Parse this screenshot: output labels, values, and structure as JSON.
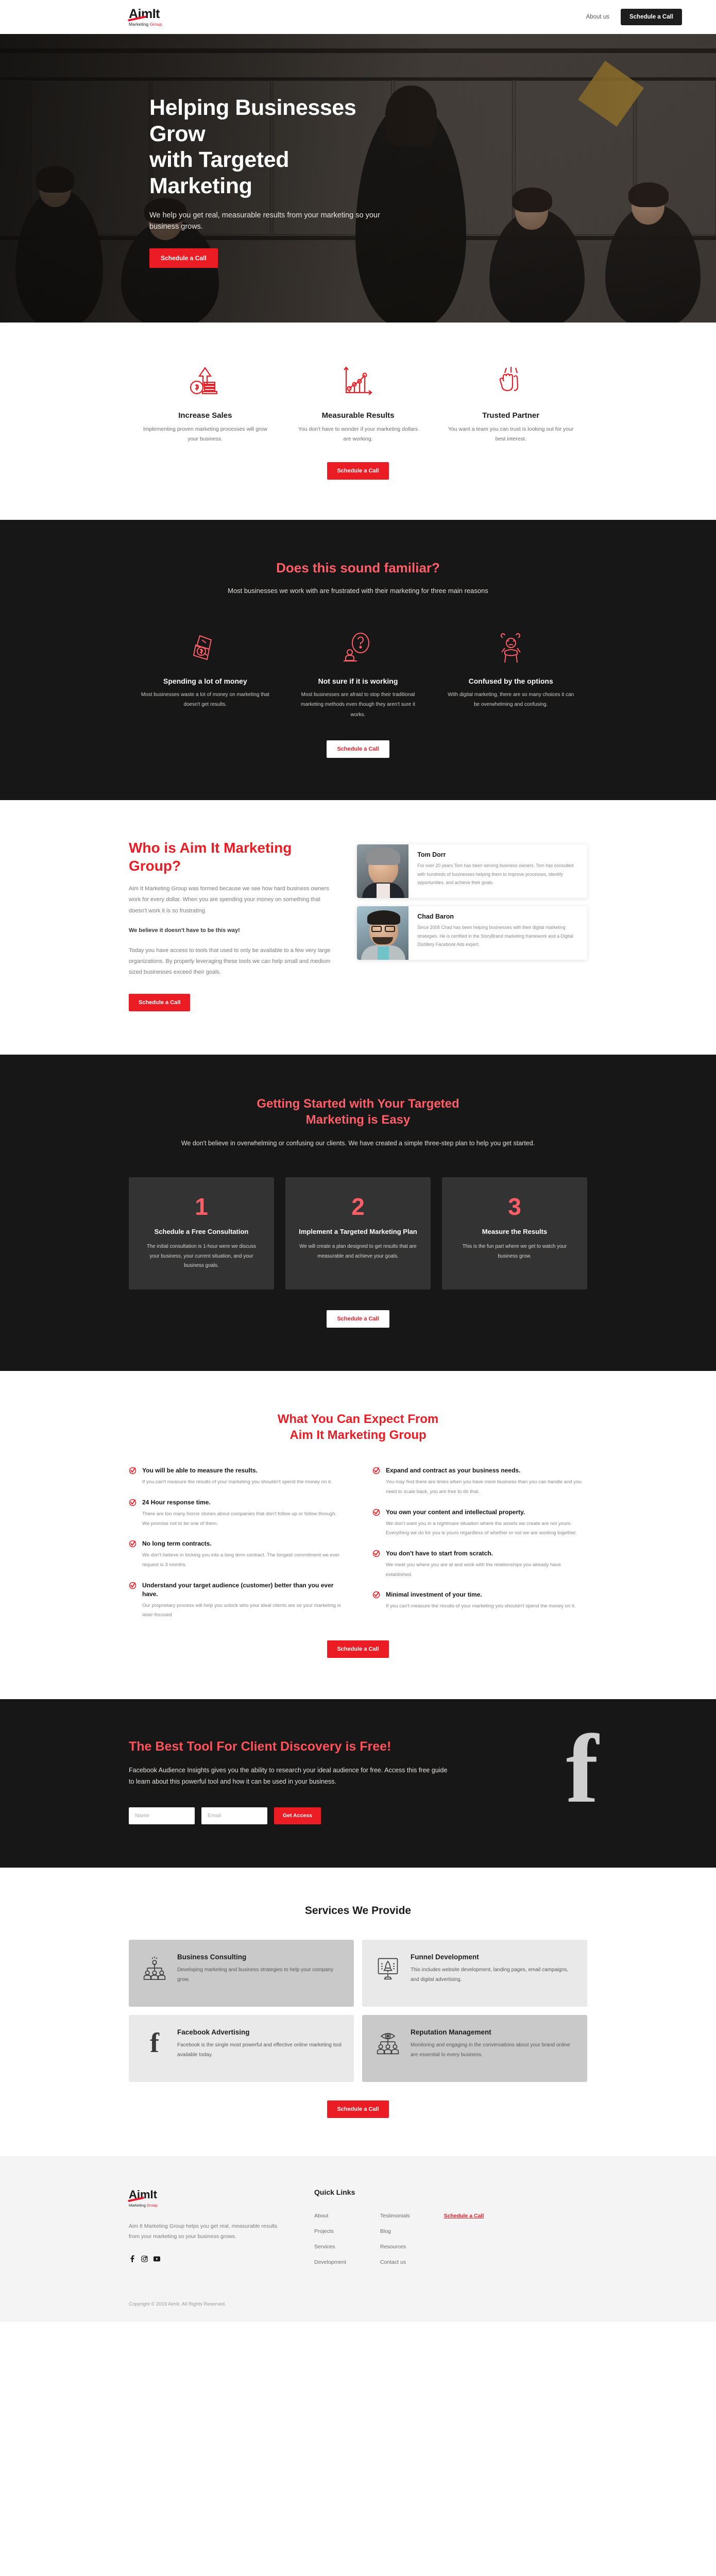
{
  "brand": {
    "name_main": "AimIt",
    "name_sub_mk": "Marketing ",
    "name_sub_gp": "Group",
    "accent_red": "#ec1c24",
    "accent_pink": "#ff5e67",
    "dark_bg": "#171717"
  },
  "header": {
    "nav_about": "About us",
    "cta": "Schedule a Call"
  },
  "hero": {
    "title_line1": "Helping Businesses Grow",
    "title_line2": "with Targeted Marketing",
    "subtitle": "We help you get real, measurable results from your marketing so your business grows.",
    "cta": "Schedule a Call"
  },
  "features": {
    "cta": "Schedule a Call",
    "items": [
      {
        "icon": "money-growth-arrow-icon",
        "title": "Increase Sales",
        "body": "Implementing proven marketing processes will grow your business."
      },
      {
        "icon": "line-chart-growth-icon",
        "title": "Measurable Results",
        "body": "You don't have to wonder if your marketing dollars are working."
      },
      {
        "icon": "high-five-hands-icon",
        "title": "Trusted Partner",
        "body": "You want a team you can trust is looking out for your best interest."
      }
    ]
  },
  "pain": {
    "heading": "Does this sound familiar?",
    "subheading": "Most businesses we work with are frustrated with their marketing for three main reasons",
    "cta": "Schedule a Call",
    "items": [
      {
        "icon": "crumpled-money-icon",
        "title": "Spending a lot of money",
        "body": "Most businesses waste a lot of money on marketing that doesn't get results."
      },
      {
        "icon": "question-mark-person-icon",
        "title": "Not sure if it is working",
        "body": "Most businesses are afraid to stop their traditional marketing methods even though they aren't sure it works."
      },
      {
        "icon": "frustrated-person-icon",
        "title": "Confused by the options",
        "body": "With digital marketing, there are so many choices it can be overwhelming and confusing."
      }
    ]
  },
  "who": {
    "heading": "Who is Aim It Marketing Group?",
    "para1": "Aim It Marketing Group was formed because we see how hard business owners work for every dollar. When you are spending your money on something that doesn't work it is so frustrating.",
    "para_bold": "We believe it doesn't have to be this way!",
    "para2": "Today you have access to tools that used to only be available to a few very large organizations. By properly leveraging these tools we can help small and medium sized businesses exceed their goals.",
    "cta": "Schedule a Call",
    "bios": [
      {
        "name": "Tom Dorr",
        "body": "For over 20 years Tom has been serving business owners. Tom has consulted with hundreds of businesses helping them to improve processes, identify opportunities, and achieve their goals."
      },
      {
        "name": "Chad Baron",
        "body": "Since 2005 Chad has been helping businesses with their digital marketing strategies. He is certified in the StoryBrand marketing framework and a Digital Distillery Facebook Ads expert."
      }
    ]
  },
  "steps": {
    "heading_line1": "Getting Started with Your Targeted",
    "heading_line2": "Marketing is Easy",
    "subheading": "We don't believe in overwhelming or confusing our clients. We have created a simple three-step plan to help you get started.",
    "cta": "Schedule a Call",
    "items": [
      {
        "num": "1",
        "title": "Schedule a Free Consultation",
        "body": "The initial consultation is 1-hour were we discuss your business, your current situation, and your business goals."
      },
      {
        "num": "2",
        "title": "Implement a Targeted Marketing Plan",
        "body": "We will create a plan designed to get results that are measurable and achieve your goals."
      },
      {
        "num": "3",
        "title": "Measure the Results",
        "body": "This is the fun part where we get to watch your business grow."
      }
    ]
  },
  "expect": {
    "heading_line1": "What You Can Expect From",
    "heading_line2": "Aim It Marketing Group",
    "cta": "Schedule a Call",
    "left": [
      {
        "title": "You will be able to measure the results.",
        "body": "If you can't measure the results of your marketing you shouldn't spend the money on it."
      },
      {
        "title": "24 Hour response time.",
        "body": "There are too many horror stories about companies that don't follow up or follow through. We promise not to be one of them."
      },
      {
        "title": "No long term contracts.",
        "body": "We don't believe in locking you into a long term contract. The longest commitment we ever request is 3 months."
      },
      {
        "title": "Understand your target audience (customer) better than you ever have.",
        "body": "Our proprietary process will help you unlock who your ideal clients are so your marketing is laser-focused"
      }
    ],
    "right": [
      {
        "title": "Expand and contract as your business needs.",
        "body": "You may find there are times when you have more business than you can handle and you need to scale back, you are free to do that."
      },
      {
        "title": "You own your content and intellectual property.",
        "body": "We don't want you in a nightmare situation where the assets we create are not yours. Everything we do for you is yours regardless of whether or not we are working together."
      },
      {
        "title": "You don't have to start from scratch.",
        "body": "We meet you where you are at and work with the relationships you already have established."
      },
      {
        "title": "Minimal investment of your time.",
        "body": "If you can't measure the results of your marketing you shouldn't spend the money on it."
      }
    ]
  },
  "fbcta": {
    "heading": "The Best Tool For Client Discovery is Free!",
    "body": "Facebook Audience Insights gives you the ability to research your ideal audience for free. Access this free guide to learn about this powerful tool and how it can be used in your business.",
    "name_placeholder": "Name",
    "name_value": "",
    "email_placeholder": "Email",
    "email_value": "",
    "submit": "Get Access",
    "glyph": "f"
  },
  "services": {
    "heading": "Services We Provide",
    "cta": "Schedule a Call",
    "items": [
      {
        "icon": "org-chart-people-icon",
        "title": "Business Consulting",
        "body": "Developing marketing and business strategies to help your company grow.",
        "shade": "shade-dark"
      },
      {
        "icon": "rocket-monitor-icon",
        "title": "Funnel Development",
        "body": "This includes website development, landing pages, email campaigns, and digital advertising.",
        "shade": "shade-light"
      },
      {
        "icon": "facebook-f-icon",
        "title": "Facebook Advertising",
        "body": "Facebook is the single most powerful and effective online marketing tool available today.",
        "shade": "shade-light"
      },
      {
        "icon": "eye-people-monitor-icon",
        "title": "Reputation Management",
        "body": "Monitoring and engaging in the conversations about your brand online are essential to every business.",
        "shade": "shade-dark"
      }
    ]
  },
  "footer": {
    "tagline": "Aim It Marketing Group helps you get real, measurable results from your marketing so your business grows.",
    "quick_links_title": "Quick Links",
    "col1": [
      "About",
      "Projects",
      "Services",
      "Development"
    ],
    "col2": [
      "Testimonials",
      "Blog",
      "Resources",
      "Contact us"
    ],
    "col3": [
      "Schedule a Call"
    ],
    "socials": [
      "facebook-icon",
      "instagram-icon",
      "youtube-icon"
    ],
    "copyright": "Copyright © 2019 AimIt. All Rights Reserved."
  }
}
